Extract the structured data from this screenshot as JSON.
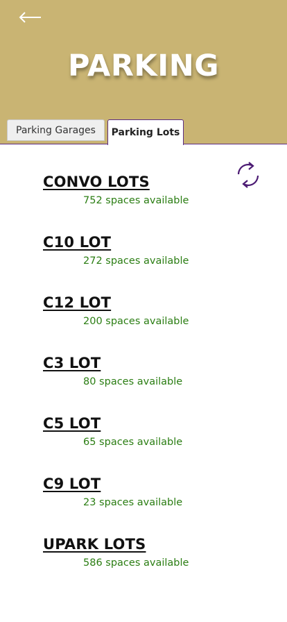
{
  "header": {
    "title": "PARKING",
    "back_icon": "arrow-left-icon",
    "background_color": "#c9b473",
    "accent_color": "#5b2c83"
  },
  "tabs": [
    {
      "label": "Parking Garages",
      "active": false
    },
    {
      "label": "Parking Lots",
      "active": true
    }
  ],
  "refresh_icon": "refresh-icon",
  "status_color": "#2a7d12",
  "lots": [
    {
      "name": "CONVO LOTS",
      "spaces": "752 spaces available"
    },
    {
      "name": "C10 LOT",
      "spaces": "272 spaces available"
    },
    {
      "name": "C12 LOT",
      "spaces": "200 spaces available"
    },
    {
      "name": "C3 LOT",
      "spaces": "80 spaces available"
    },
    {
      "name": "C5 LOT",
      "spaces": "65 spaces available"
    },
    {
      "name": "C9 LOT",
      "spaces": "23 spaces available"
    },
    {
      "name": "UPARK LOTS",
      "spaces": "586 spaces available"
    }
  ]
}
